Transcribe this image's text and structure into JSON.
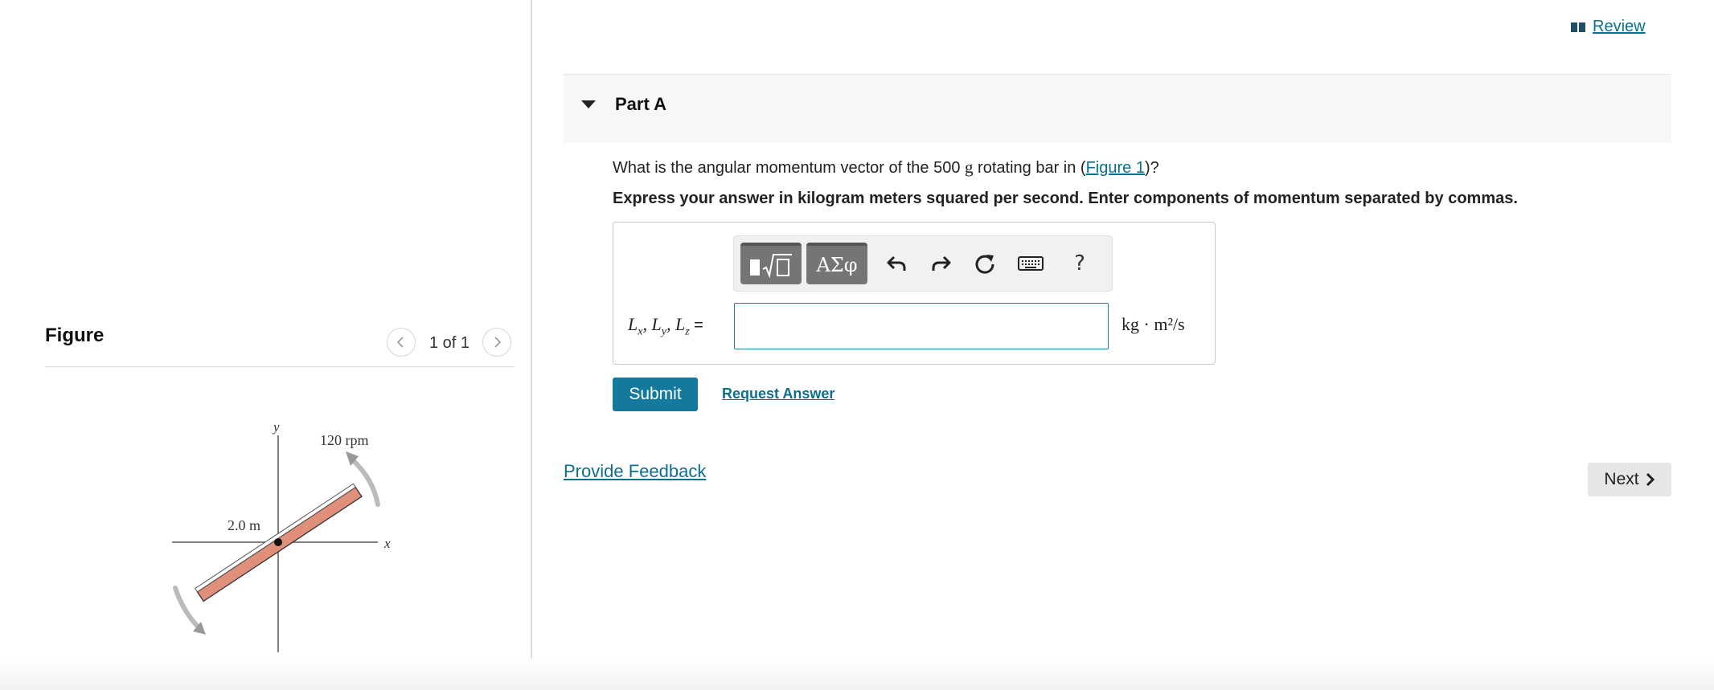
{
  "review": {
    "label": " Review",
    "icon": "book-icon"
  },
  "figure_panel": {
    "title": "Figure",
    "counter": "1 of 1",
    "prev_icon": "chevron-left-icon",
    "next_icon": "chevron-right-icon",
    "diagram": {
      "length_label": "2.0 m",
      "speed_label": "120 rpm",
      "x_axis_label": "x",
      "y_axis_label": "y",
      "bar_color": "#e0907a"
    }
  },
  "part": {
    "title": "Part A",
    "question_prefix": "What is the angular momentum vector of the 500 ",
    "question_mass_unit": "g",
    "question_middle": " rotating bar in (",
    "question_link": "Figure 1",
    "question_suffix": ")?",
    "instructions": "Express your answer in kilogram meters squared per second. Enter components of momentum separated by commas."
  },
  "toolbar": {
    "symbols_label": "ΑΣφ",
    "help_label": "?",
    "icons": [
      "templates-icon",
      "symbols-icon",
      "undo-icon",
      "redo-icon",
      "reset-icon",
      "keyboard-icon",
      "help-icon"
    ]
  },
  "answer": {
    "var_label_math": "Lx, Ly, Lz",
    "equals": "=",
    "value": "",
    "unit_label": "kg · m²/s"
  },
  "actions": {
    "submit": "Submit",
    "request": "Request Answer",
    "feedback": "Provide Feedback",
    "next": "Next"
  },
  "colors": {
    "accent": "#137a9d",
    "link": "#0c6f8c"
  }
}
